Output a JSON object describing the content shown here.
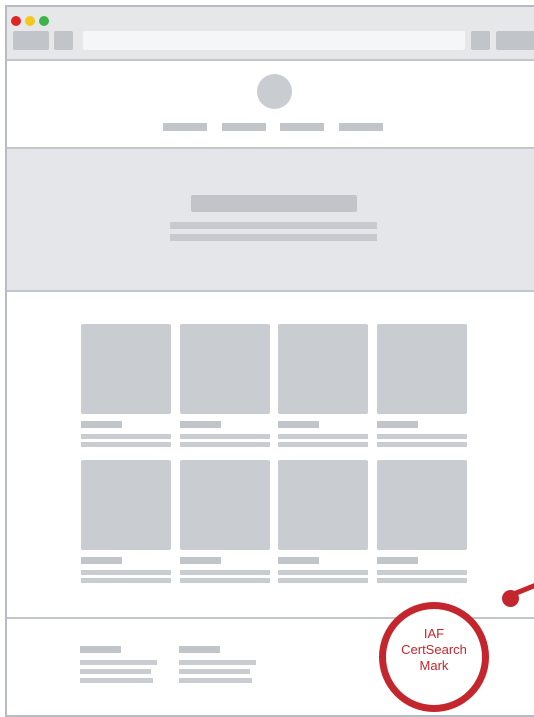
{
  "window": {
    "traffic_lights": [
      {
        "name": "close",
        "color": "#e02424"
      },
      {
        "name": "minimize",
        "color": "#f2c81a"
      },
      {
        "name": "maximize",
        "color": "#3db24a"
      }
    ]
  },
  "header": {
    "nav_items": 4
  },
  "products": {
    "rows": 2,
    "columns": 4
  },
  "callout": {
    "line1": "IAF",
    "line2": "CertSearch",
    "line3": "Mark",
    "color": "#c4262e"
  }
}
